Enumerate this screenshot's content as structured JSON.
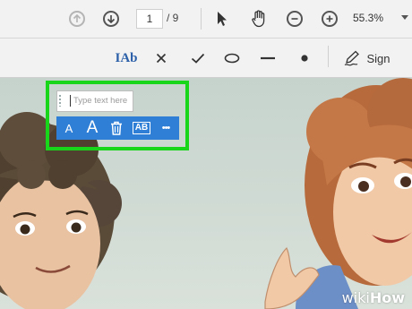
{
  "toolbar": {
    "page_current": "1",
    "page_total": "/ 9",
    "zoom": "55.3%"
  },
  "signbar": {
    "sign_label": "Sign",
    "text_tool_glyph": "IAb"
  },
  "annotation": {
    "placeholder": "Type text here",
    "small_font_glyph": "A",
    "large_font_glyph": "A",
    "convert_glyph": "AB",
    "more_glyph": "•••"
  },
  "colors": {
    "highlight": "#18d71a",
    "annotation_toolbar": "#2f7fd6",
    "text_tool_accent": "#2b5fa8"
  },
  "watermark": {
    "prefix": "wiki",
    "suffix": "How"
  }
}
